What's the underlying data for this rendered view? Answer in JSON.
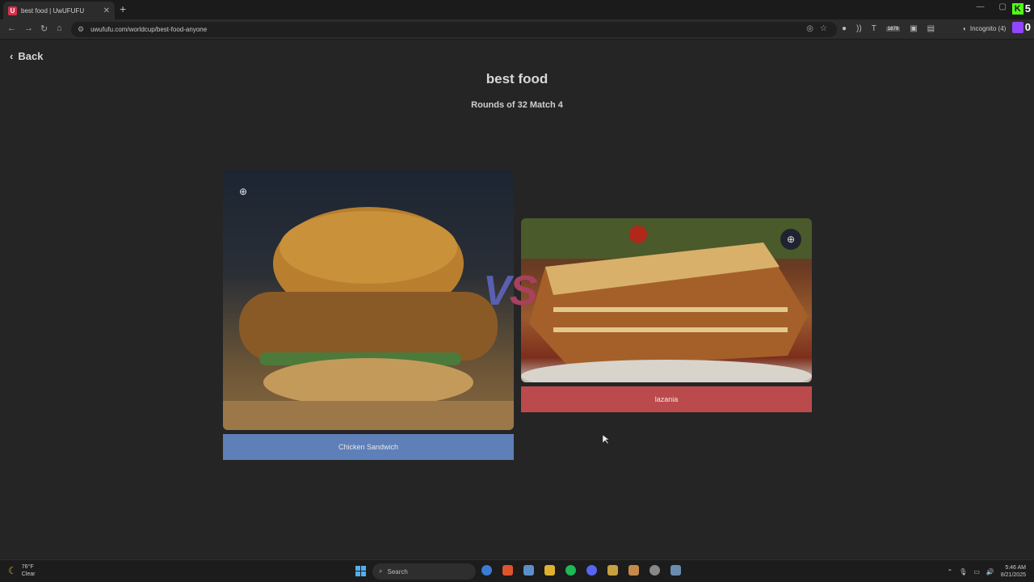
{
  "browser": {
    "tab_title": "best food | UwUFUFU",
    "tab_favicon": "U",
    "url": "uwufufu.com/worldcup/best-food-anyone",
    "incognito_label": "Incognito (4)",
    "ext_badge": "1879",
    "kick_count": "5",
    "twitch_count": "0"
  },
  "page": {
    "back_label": "Back",
    "title": "best food",
    "subtitle": "Rounds of 32 Match 4",
    "vs_v": "V",
    "vs_s": "S"
  },
  "match": {
    "left": {
      "label": "Chicken Sandwich",
      "color": "#5e7fb8"
    },
    "right": {
      "label": "lazania",
      "color": "#bb4a4c"
    }
  },
  "taskbar": {
    "weather_temp": "76°F",
    "weather_cond": "Clear",
    "search_label": "Search",
    "time": "5:46 AM",
    "date": "8/21/2025"
  }
}
